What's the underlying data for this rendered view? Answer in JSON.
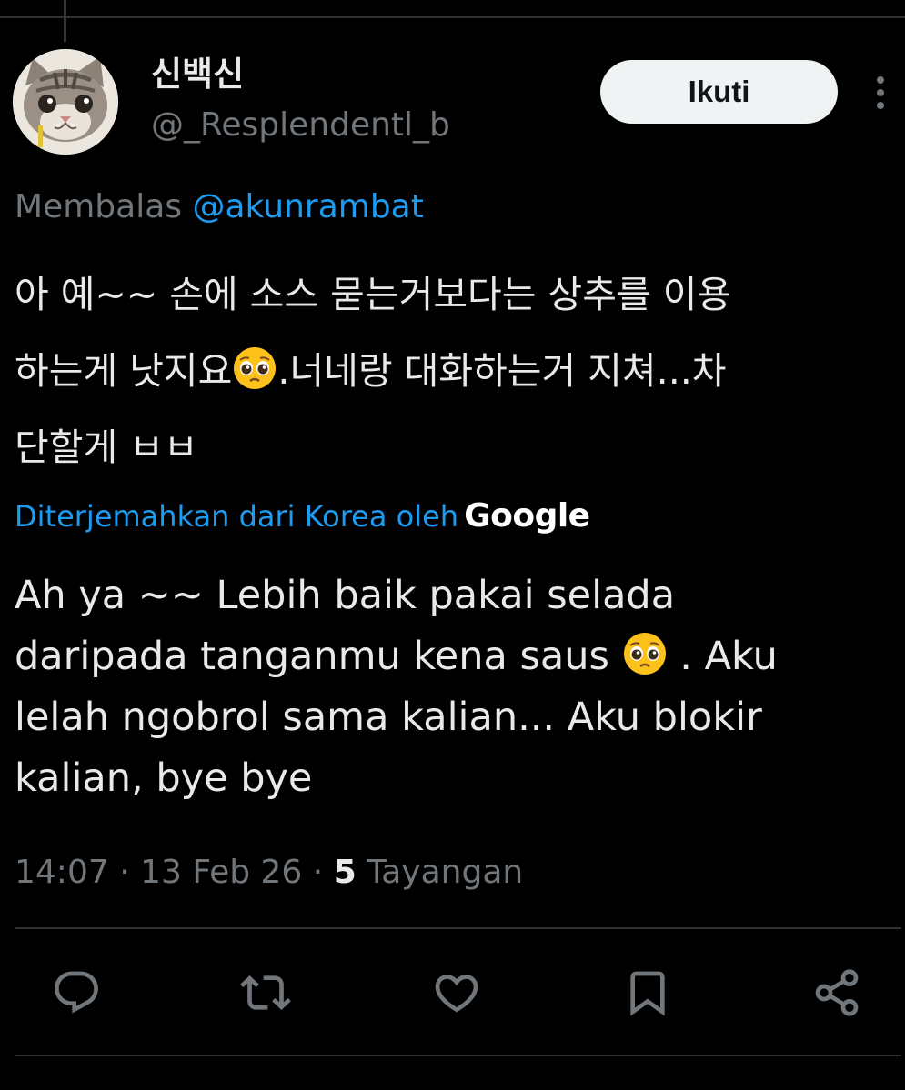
{
  "author": {
    "display_name": "신백신",
    "handle": "@_Resplendentl_b",
    "avatar_icon": "kitten-avatar"
  },
  "follow_button": {
    "label": "Ikuti"
  },
  "more_button": {
    "icon": "more-vertical-icon"
  },
  "reply_context": {
    "prefix": "Membalas",
    "mention": "@akunrambat"
  },
  "tweet": {
    "lines": [
      {
        "before": "아 예~~ 손에 소스 묻는거보다는 상추를 이용",
        "after": ""
      },
      {
        "before": "하는게 낫지요",
        "after": ".너네랑 대화하는거 지쳐...차"
      },
      {
        "before": "단할게 ㅂㅂ",
        "after": ""
      }
    ],
    "emoji": "pleading-face"
  },
  "translation_notice": {
    "text": "Diterjemahkan dari Korea oleh",
    "provider": "Google"
  },
  "translation": {
    "lines": [
      {
        "before": "Ah ya ~~ Lebih baik pakai selada",
        "after": ""
      },
      {
        "before": "daripada tanganmu kena saus ",
        "after": " . Aku"
      },
      {
        "before": "lelah ngobrol sama kalian... Aku blokir",
        "after": ""
      },
      {
        "before": "kalian, bye bye",
        "after": ""
      }
    ]
  },
  "meta": {
    "time": "14:07",
    "separator": " · ",
    "date": "13 Feb 26",
    "views_count": "5",
    "views_label": " Tayangan"
  },
  "actions": [
    {
      "name": "reply",
      "icon": "reply-icon"
    },
    {
      "name": "retweet",
      "icon": "retweet-icon"
    },
    {
      "name": "like",
      "icon": "heart-icon"
    },
    {
      "name": "bookmark",
      "icon": "bookmark-icon"
    },
    {
      "name": "share",
      "icon": "share-icon"
    }
  ],
  "colors": {
    "background": "#000000",
    "primary_text": "#e7e9ea",
    "secondary_text": "#71767b",
    "link": "#1d9bf0",
    "divider": "#2f3336",
    "follow_button_bg": "#eff3f4"
  }
}
